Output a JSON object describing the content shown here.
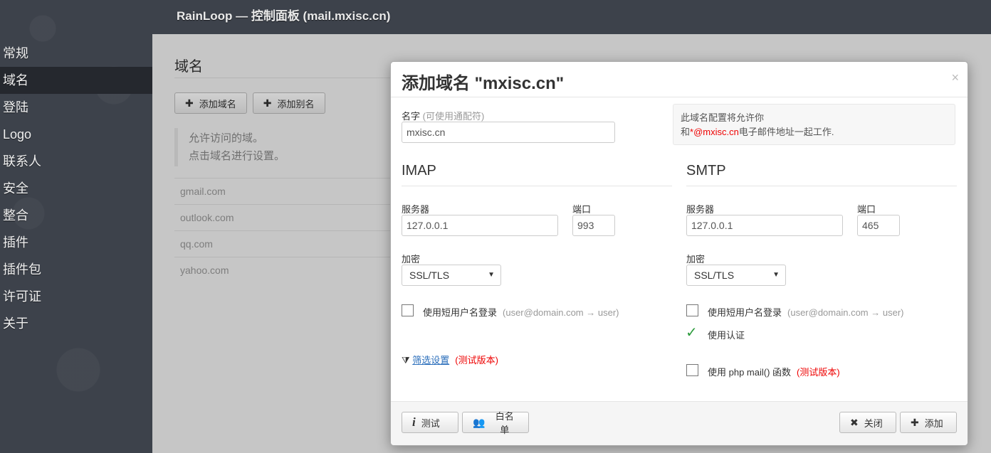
{
  "app": {
    "title": "RainLoop — 控制面板  (mail.mxisc.cn)"
  },
  "sidebar": {
    "items": [
      {
        "label": "常规"
      },
      {
        "label": "域名"
      },
      {
        "label": "登陆"
      },
      {
        "label": "Logo"
      },
      {
        "label": "联系人"
      },
      {
        "label": "安全"
      },
      {
        "label": "整合"
      },
      {
        "label": "插件"
      },
      {
        "label": "插件包"
      },
      {
        "label": "许可证"
      },
      {
        "label": "关于"
      }
    ]
  },
  "domains_page": {
    "title": "域名",
    "add_domain_label": "添加域名",
    "add_alias_label": "添加别名",
    "notice_line1": "允许访问的域。",
    "notice_line2": "点击域名进行设置。",
    "domains": [
      "gmail.com",
      "outlook.com",
      "qq.com",
      "yahoo.com"
    ]
  },
  "modal": {
    "title": "添加域名 \"mxisc.cn\"",
    "close_glyph": "×",
    "name_label": "名字",
    "name_hint": "(可使用通配符)",
    "name_value": "mxisc.cn",
    "info_line1": "此域名配置将允许你",
    "info_prefix": "和",
    "info_highlight": "*@mxisc.cn",
    "info_suffix": "电子邮件地址一起工作.",
    "imap": {
      "heading": "IMAP",
      "server_label": "服务器",
      "server_value": "127.0.0.1",
      "port_label": "端口",
      "port_value": "993",
      "encryption_label": "加密",
      "encryption_value": "SSL/TLS",
      "short_login_label": "使用短用户名登录",
      "short_login_hint": "(user@domain.com → user)",
      "filter_label": "筛选设置",
      "filter_badge": "(测试版本)"
    },
    "smtp": {
      "heading": "SMTP",
      "server_label": "服务器",
      "server_value": "127.0.0.1",
      "port_label": "端口",
      "port_value": "465",
      "encryption_label": "加密",
      "encryption_value": "SSL/TLS",
      "short_login_label": "使用短用户名登录",
      "short_login_hint": "(user@domain.com → user)",
      "auth_label": "使用认证",
      "php_mail_label": "使用 php mail() 函数",
      "php_mail_badge": "(测试版本)"
    },
    "footer": {
      "test_label": "测试",
      "whitelist_label": "白名单",
      "close_label": "关闭",
      "add_label": "添加"
    }
  },
  "colors": {
    "accent_red": "#e00000",
    "link_blue": "#2a6ebb",
    "check_green": "#2e9c3e"
  }
}
